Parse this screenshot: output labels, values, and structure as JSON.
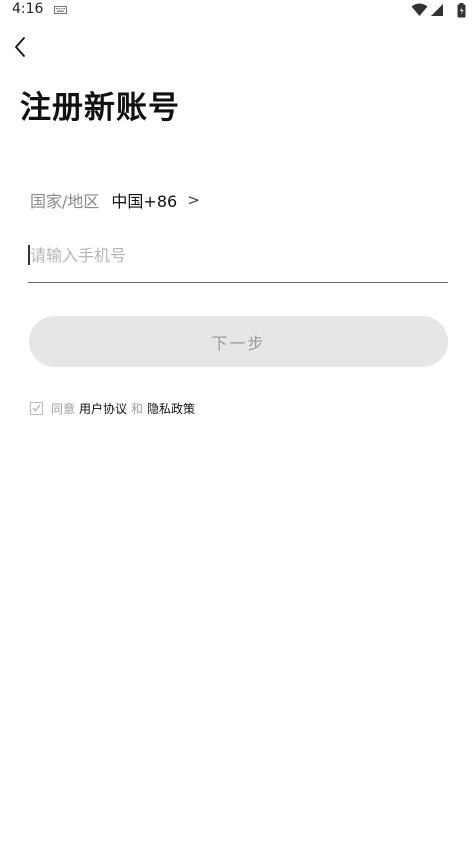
{
  "status_bar": {
    "time": "4:16",
    "icons": [
      "keyboard-icon",
      "wifi-icon",
      "signal-icon",
      "battery-icon"
    ]
  },
  "nav": {
    "back_icon": "chevron-left-icon"
  },
  "page": {
    "title": "注册新账号"
  },
  "country": {
    "label": "国家/地区",
    "value": "中国+86",
    "chevron": ">"
  },
  "phone": {
    "placeholder": "请输入手机号",
    "value": ""
  },
  "next_button": {
    "label": "下一步",
    "background": "#e6e6e6",
    "text_color": "#9a9a9a"
  },
  "agreement": {
    "checked": true,
    "prefix": "同意",
    "user_agreement": "用户协议",
    "and": "和",
    "privacy_policy": "隐私政策"
  }
}
